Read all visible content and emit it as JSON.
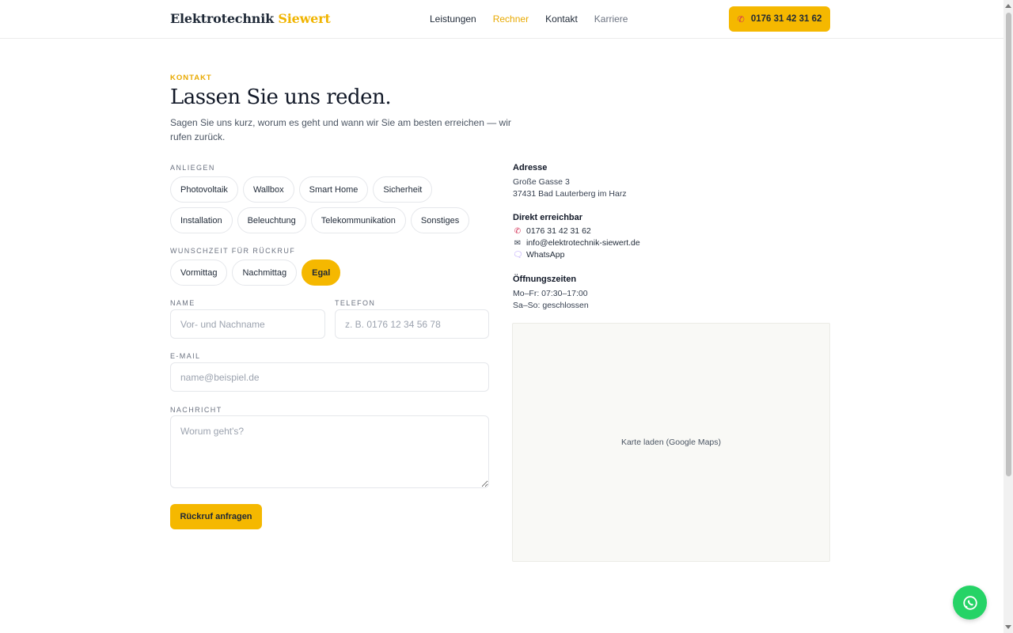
{
  "header": {
    "brand_main": "Elektrotechnik",
    "brand_accent": "Siewert",
    "nav": [
      {
        "label": "Leistungen"
      },
      {
        "label": "Rechner"
      },
      {
        "label": "Kontakt"
      },
      {
        "label": "Karriere"
      }
    ],
    "call_label": "0176 31 42 31 62"
  },
  "hero": {
    "eyebrow": "KONTAKT",
    "title": "Lassen Sie uns reden.",
    "lead": "Sagen Sie uns kurz, worum es geht und wann wir Sie am besten erreichen — wir rufen zurück."
  },
  "form": {
    "concern_label": "ANLIEGEN",
    "concerns": [
      "Photovoltaik",
      "Wallbox",
      "Smart Home",
      "Sicherheit",
      "Installation",
      "Beleuchtung",
      "Telekommunikation",
      "Sonstiges"
    ],
    "time_label": "WUNSCHZEIT FÜR RÜCKRUF",
    "times": [
      "Vormittag",
      "Nachmittag",
      "Egal"
    ],
    "selected_time": "Egal",
    "name_label": "NAME",
    "name_placeholder": "Vor- und Nachname",
    "phone_label": "TELEFON",
    "phone_placeholder": "z. B. 0176 12 34 56 78",
    "email_label": "E-MAIL",
    "email_placeholder": "name@beispiel.de",
    "message_label": "NACHRICHT",
    "message_placeholder": "Worum geht's?",
    "submit_label": "Rückruf anfragen"
  },
  "contact": {
    "address_heading": "Adresse",
    "address_line1": "Große Gasse 3",
    "address_line2": "37431 Bad Lauterberg im Harz",
    "direct_heading": "Direkt erreichbar",
    "phone": "0176 31 42 31 62",
    "email": "info@elektrotechnik-siewert.de",
    "whatsapp": "WhatsApp",
    "hours_heading": "Öffnungszeiten",
    "hours_weekdays": "Mo–Fr: 07:30–17:00",
    "hours_weekend": "Sa–So: geschlossen",
    "map_label": "Karte laden (Google Maps)"
  },
  "colors": {
    "accent": "#f5b800",
    "whatsapp": "#25d366",
    "phone_icon": "#d32f55"
  },
  "icons": {
    "call_button": "phone-icon",
    "fab": "whatsapp-icon"
  }
}
